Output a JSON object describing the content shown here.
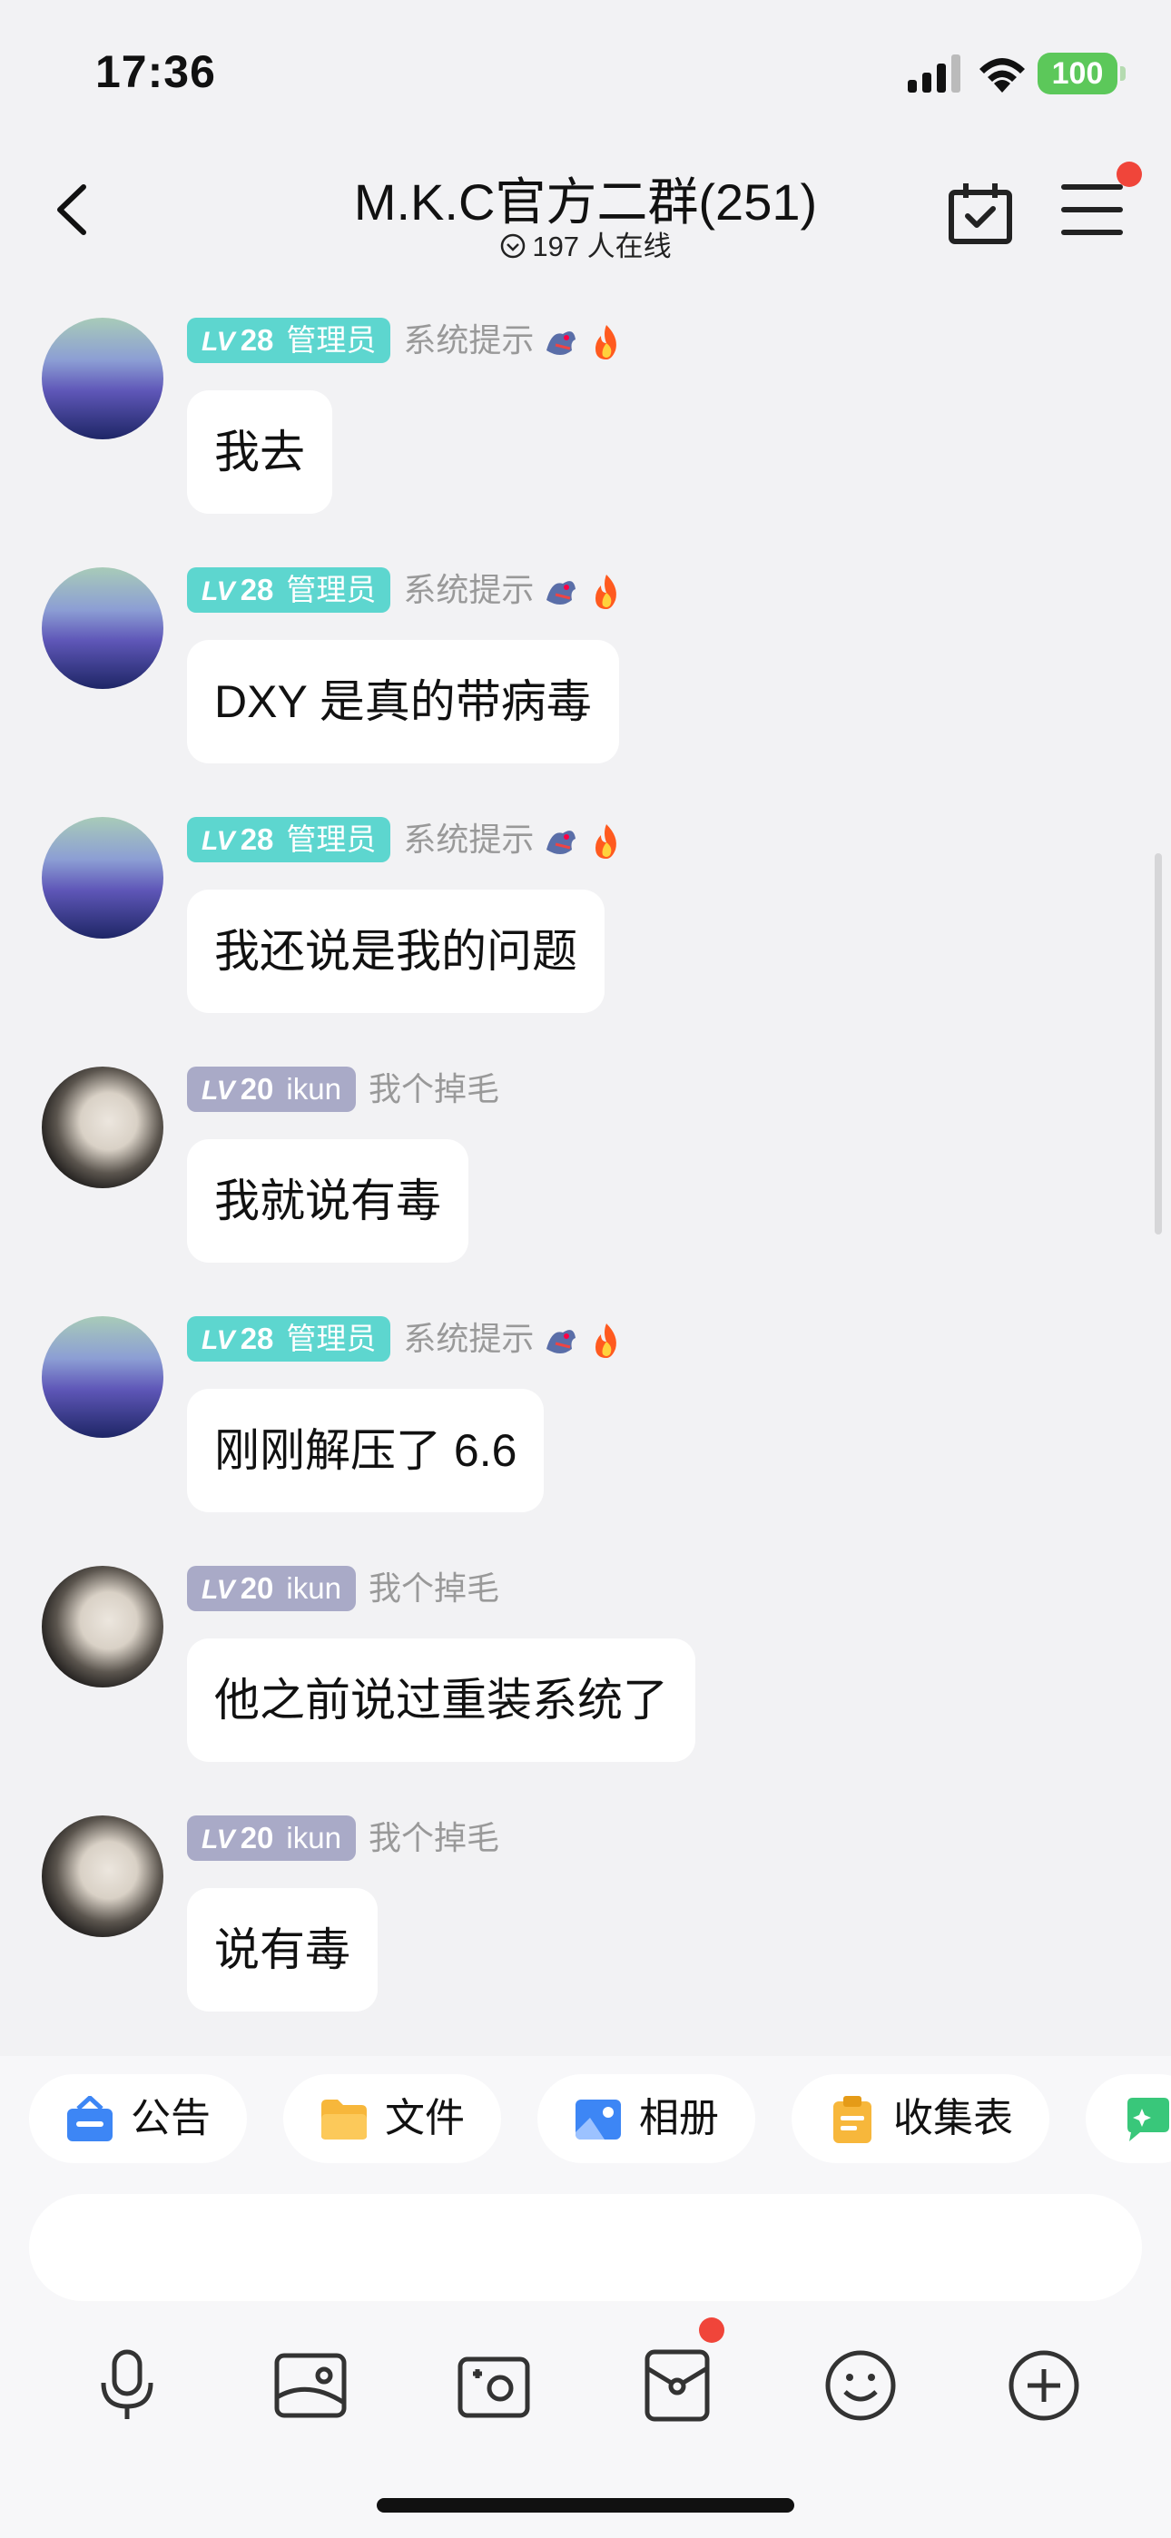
{
  "status_bar": {
    "time": "17:36",
    "battery": "100"
  },
  "nav": {
    "title": "M.K.C官方二群(251)",
    "online": "197 人在线"
  },
  "messages": [
    {
      "level": "28",
      "role": "管理员",
      "nick": "系统提示",
      "text": "我去",
      "avatar": "mountain-avatar",
      "decorations": true
    },
    {
      "level": "28",
      "role": "管理员",
      "nick": "系统提示",
      "text": "DXY 是真的带病毒",
      "avatar": "mountain-avatar",
      "decorations": true
    },
    {
      "level": "28",
      "role": "管理员",
      "nick": "系统提示",
      "text": "我还说是我的问题",
      "avatar": "mountain-avatar",
      "decorations": true
    },
    {
      "level": "20",
      "role": "ikun",
      "nick": "我个掉毛",
      "text": "我就说有毒",
      "avatar": "face-avatar",
      "decorations": false
    },
    {
      "level": "28",
      "role": "管理员",
      "nick": "系统提示",
      "text": "刚刚解压了 6.6",
      "avatar": "mountain-avatar",
      "decorations": true
    },
    {
      "level": "20",
      "role": "ikun",
      "nick": "我个掉毛",
      "text": "他之前说过重装系统了",
      "avatar": "face-avatar",
      "decorations": false
    },
    {
      "level": "20",
      "role": "ikun",
      "nick": "我个掉毛",
      "text": "说有毒",
      "avatar": "face-avatar",
      "decorations": false
    }
  ],
  "lv_prefix": "LV",
  "quick_actions": [
    {
      "label": "公告",
      "icon": "announcement-icon"
    },
    {
      "label": "文件",
      "icon": "folder-icon"
    },
    {
      "label": "相册",
      "icon": "album-icon"
    },
    {
      "label": "收集表",
      "icon": "clipboard-icon"
    }
  ],
  "toolbar": [
    "microphone-icon",
    "image-icon",
    "camera-icon",
    "red-packet-icon",
    "emoji-icon",
    "plus-icon"
  ],
  "colors": {
    "admin_badge": "#5dd6cf",
    "member_badge": "#a9aac7",
    "notification_dot": "#f0453a"
  }
}
